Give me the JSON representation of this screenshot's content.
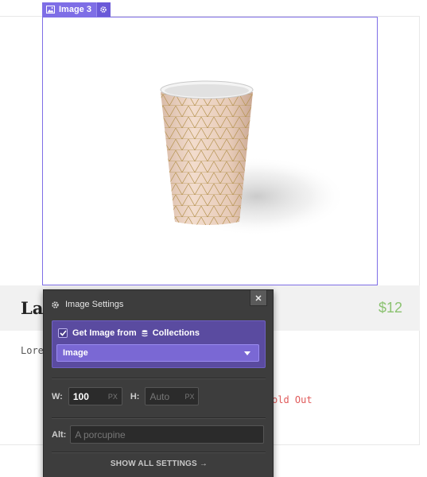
{
  "selection": {
    "element_label": "Image 3"
  },
  "product": {
    "title": "Lab",
    "price": "$12",
    "body": "Lore",
    "status": "old Out"
  },
  "image_settings": {
    "title": "Image Settings",
    "collections": {
      "checked": true,
      "prefix": "Get Image from",
      "source": "Collections",
      "selected_field": "Image"
    },
    "width": {
      "label": "W:",
      "value": "100",
      "unit": "PX"
    },
    "height": {
      "label": "H:",
      "placeholder": "Auto",
      "unit": "PX"
    },
    "alt": {
      "label": "Alt:",
      "placeholder": "A porcupine"
    },
    "show_all_label": "SHOW ALL SETTINGS →"
  },
  "colors": {
    "selection_accent": "#7e6ee6",
    "panel_bg": "#3d3d3d",
    "collection_bg": "#5a4ba0",
    "price_green": "#8bc270",
    "sold_out_red": "#e05a5a"
  },
  "icons": [
    "image-icon",
    "gear-icon",
    "close-icon",
    "database-icon",
    "checkmark-icon",
    "chevron-down-icon"
  ]
}
